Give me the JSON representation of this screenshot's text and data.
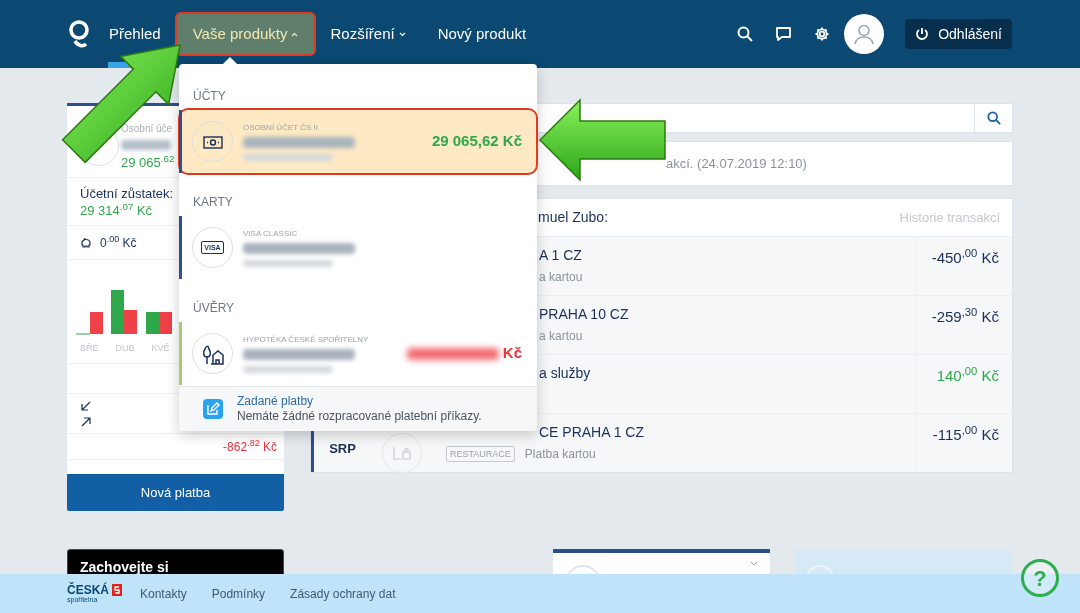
{
  "header": {
    "nav": [
      {
        "label": "Přehled",
        "has_menu": false,
        "selected": false,
        "outlined": false
      },
      {
        "label": "Vaše produkty",
        "has_menu": true,
        "expanded": true,
        "selected": true,
        "outlined": true
      },
      {
        "label": "Rozšíření",
        "has_menu": true,
        "expanded": false,
        "selected": false,
        "outlined": false
      },
      {
        "label": "Nový produkt",
        "has_menu": false,
        "selected": false,
        "outlined": false
      }
    ],
    "logout": "Odhlášení"
  },
  "left_card": {
    "product_label": "Osobní úče",
    "balance": "29 065$^{.62}$",
    "booked_label": "Účetní zůstatek:",
    "booked": "29 314$^{.07}$ Kč",
    "savings": "0$^{.00}$ Kč",
    "chart_labels": [
      "BŘE",
      "DUB",
      "KVĚ"
    ],
    "spending": "-862$^{.82}$ Kč",
    "new_payment": "Nová platba"
  },
  "status": "akcí. (24.07.2019 12:10)",
  "transactions": {
    "title": "muel Zubo:",
    "history": "Historie transakcí",
    "rows": [
      {
        "date": "",
        "tag": "",
        "title": "A 1 CZ",
        "subtitle": "a kartou",
        "amount": "-450$^{,00}$ Kč",
        "positive": false
      },
      {
        "date": "",
        "tag": "",
        "title": "PRAHA 10 CZ",
        "subtitle": "a kartou",
        "amount": "-259$^{,30}$ Kč",
        "positive": false
      },
      {
        "date": "",
        "tag": "",
        "title": "a služby",
        "subtitle": "",
        "amount": "140$^{,00}$ Kč",
        "positive": true
      },
      {
        "date": "SRP",
        "tag": "RESTAURACE",
        "title": "CE PRAHA 1 CZ",
        "subtitle": "Platba kartou",
        "amount": "-115$^{,00}$ Kč",
        "positive": false
      }
    ]
  },
  "dropdown": {
    "sections": [
      {
        "title": "ÚČTY",
        "items": [
          {
            "kind": "account",
            "label": "OSOBNÍ ÚČET ČS II",
            "amount": "29 065,62 Kč",
            "color": "#2d4f8e",
            "selected": true,
            "outlined": true
          }
        ]
      },
      {
        "title": "KARTY",
        "items": [
          {
            "kind": "card",
            "label": "VISA CLASSIC",
            "icon_text": "VISA",
            "color": "#2d4f8e",
            "selected": false,
            "outlined": false
          }
        ]
      },
      {
        "title": "ÚVĚRY",
        "items": [
          {
            "kind": "loan",
            "label": "HYPOTÉKA ČESKÉ SPOŘITELNY",
            "amount": "Kč",
            "color": "#a5cf6a",
            "selected": false,
            "outlined": false
          }
        ]
      }
    ],
    "footer": {
      "link": "Zadané platby",
      "text": "Nemáte žádné rozpracované platební příkazy."
    }
  },
  "promo": {
    "title": "Zachovejte si"
  },
  "footer": {
    "logo_top": "ČESKÁ",
    "logo_bottom": "spořitelna",
    "links": [
      "Kontakty",
      "Podmínky",
      "Zásady ochrany dat"
    ],
    "help": "?"
  }
}
